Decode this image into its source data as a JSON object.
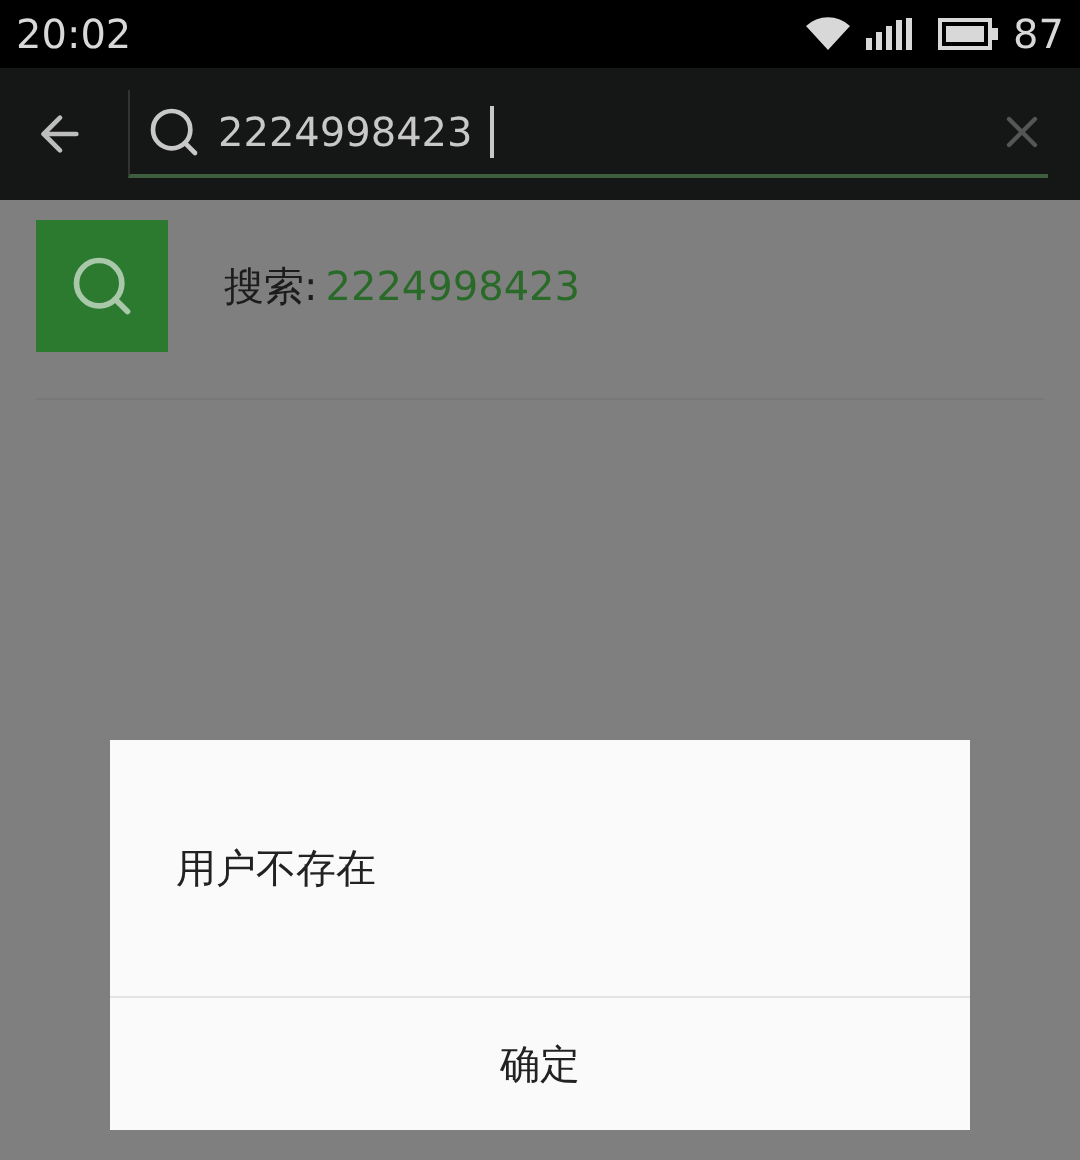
{
  "status_bar": {
    "time": "20:02",
    "battery": "87"
  },
  "search": {
    "value": "2224998423"
  },
  "result": {
    "label": "搜索:",
    "query": "2224998423"
  },
  "dialog": {
    "message": "用户不存在",
    "button": "确定"
  }
}
